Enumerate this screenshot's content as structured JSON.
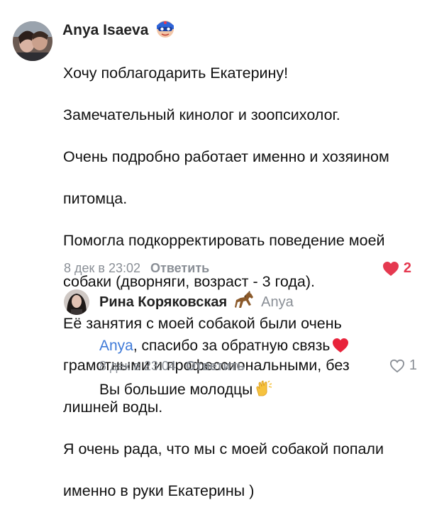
{
  "comments": [
    {
      "author": "Anya Isaeva",
      "badge_icon": "superhero-mask-icon",
      "body_lines": [
        "Хочу поблагодарить Екатерину!",
        "Замечательный кинолог и зоопсихолог.",
        "Очень подробно работает именно и хозяином",
        "питомца.",
        "Помогла подкорректировать поведение моей",
        "собаки (дворняги, возраст - 3 года).",
        "Её занятия с моей собакой были очень",
        "грамотными и профессиональными, без",
        "лишней воды.",
        "Я очень рада, что мы с моей собакой попали",
        "именно в руки Екатерины )"
      ],
      "date": "8 дек в 23:02",
      "reply_label": "Ответить",
      "likes": "2",
      "like_color": "#e53950"
    },
    {
      "author": "Рина Коряковская",
      "badge_icon": "horse-icon",
      "reply_to": "Anya",
      "mention": "Anya",
      "line1_rest": ", спасибо за обратную связь",
      "line2": "Вы большие молодцы",
      "date": "8 дек в 23:04",
      "reply_label": "Ответить",
      "likes": "1"
    }
  ],
  "colors": {
    "link": "#3f7ad8",
    "muted": "#8a8f96",
    "heart": "#e53950"
  }
}
